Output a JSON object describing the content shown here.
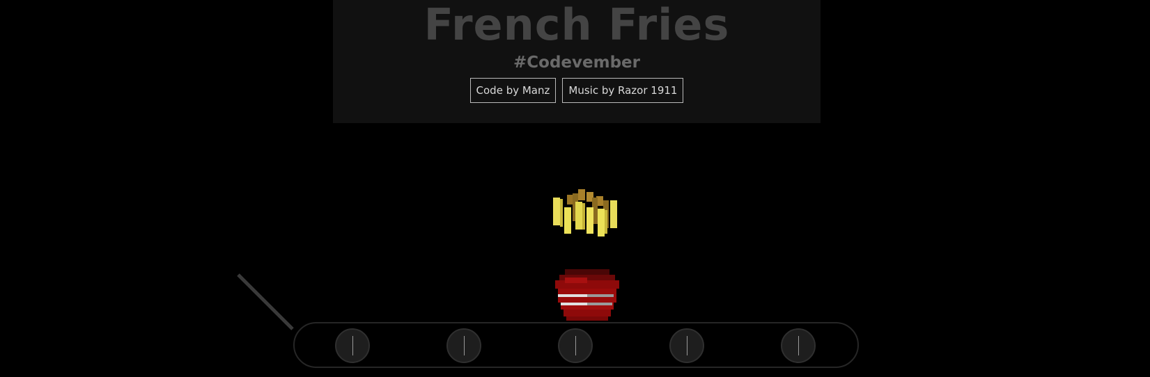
{
  "header": {
    "title": "French Fries",
    "subtitle": "#Codevember",
    "credits": [
      {
        "label": "Code by Manz"
      },
      {
        "label": "Music by Razor 1911"
      }
    ]
  },
  "scene": {
    "colors": {
      "background": "#000000",
      "header_background": "#111111",
      "fries": "#e8d84a",
      "fries_tips": "#a8802a",
      "bucket": "#9a0a0a",
      "bucket_stripe": "#d8d8d8",
      "belt_outline": "#262626",
      "roller": "#1e1e1e"
    },
    "roller_count": 5
  }
}
